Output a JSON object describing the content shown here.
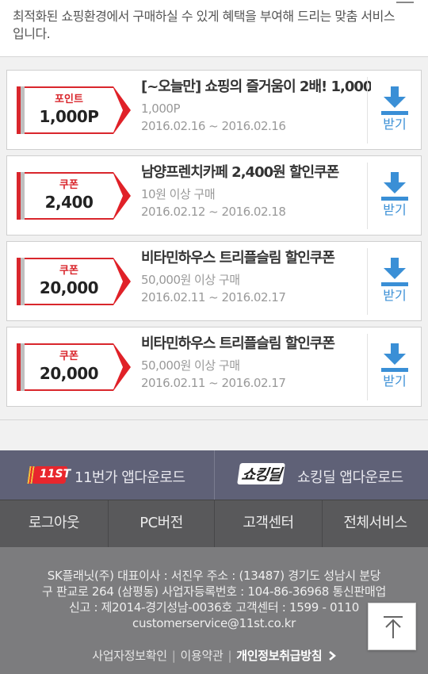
{
  "intro": {
    "text_line1": "최적화된 쇼핑환경에서 구매하실 수 있게 혜택을 부여해 드리는 맞춤 서비스",
    "text_line2": "입니다."
  },
  "coupons": [
    {
      "type": "포인트",
      "amount": "1,000P",
      "title": "[~오늘만] 쇼핑의 즐거움이 2배! 1,000",
      "sub": "1,000P",
      "period": "2016.02.16 ~ 2016.02.16",
      "download_label": "받기"
    },
    {
      "type": "쿠폰",
      "amount": "2,400",
      "title": "남양프렌치카페 2,400원 할인쿠폰",
      "sub": "10원 이상 구매",
      "period": "2016.02.12 ~ 2016.02.18",
      "download_label": "받기"
    },
    {
      "type": "쿠폰",
      "amount": "20,000",
      "title": "비타민하우스 트리플슬림 할인쿠폰",
      "sub": "50,000원 이상 구매",
      "period": "2016.02.11 ~ 2016.02.17",
      "download_label": "받기"
    },
    {
      "type": "쿠폰",
      "amount": "20,000",
      "title": "비타민하우스 트리플슬림 할인쿠폰",
      "sub": "50,000원 이상 구매",
      "period": "2016.02.11 ~ 2016.02.17",
      "download_label": "받기"
    }
  ],
  "appbar": {
    "left_logo_text": "11ST",
    "left_label": "11번가 앱다운로드",
    "right_logo_text": "쇼킹딜",
    "right_label": "쇼킹딜 앱다운로드"
  },
  "nav": {
    "items": [
      "로그아웃",
      "PC버전",
      "고객센터",
      "전체서비스"
    ]
  },
  "footer": {
    "line1": "SK플래닛(주) 대표이사 : 서진우 주소 : (13487) 경기도 성남시 분당",
    "line2": "구 판교로 264 (삼평동) 사업자등록번호 : 104-86-36968 통신판매업",
    "line3": "신고 : 제2014-경기성남-0036호 고객센터 : 1599 - 0110",
    "line4": "customerservice@11st.co.kr",
    "links": [
      "사업자정보확인",
      "이용약관",
      "개인정보취급방침"
    ],
    "more_icon": "chevron-right-icon"
  },
  "colors": {
    "accent_red": "#d9262c",
    "download_blue": "#3a8fd6",
    "appbar_bg": "#5f6177",
    "nav_bg": "#59595b",
    "footer_bg": "#7c7c7e"
  }
}
